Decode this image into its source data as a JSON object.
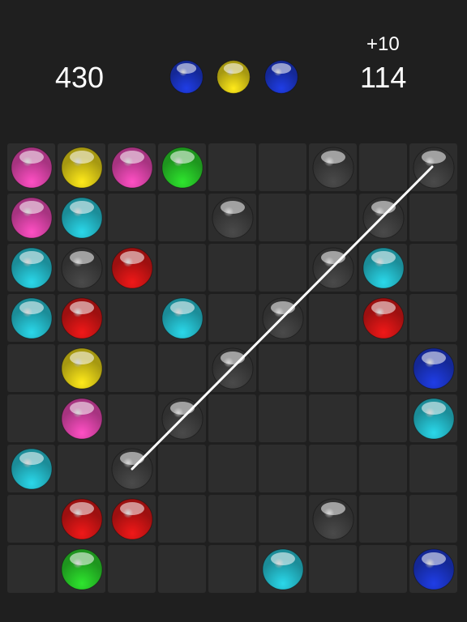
{
  "header": {
    "score": "430",
    "bonus": "+10",
    "counter": "114"
  },
  "next_balls": [
    "blue",
    "yellow",
    "blue"
  ],
  "colors": {
    "pink": "#ff4fc4",
    "yellow": "#ffea1a",
    "green": "#2ee52e",
    "cyan": "#2ad8ea",
    "red": "#f01818",
    "blue": "#1f3de6",
    "gray": "#4a4a4a"
  },
  "grid": {
    "rows": 9,
    "cols": 9,
    "cells": [
      [
        "pink",
        "yellow",
        "pink",
        "green",
        null,
        null,
        "gray",
        null,
        "gray"
      ],
      [
        "pink",
        "cyan",
        null,
        null,
        "gray",
        null,
        null,
        "gray",
        null
      ],
      [
        "cyan",
        "gray",
        "red",
        null,
        null,
        null,
        "gray",
        "cyan",
        null
      ],
      [
        "cyan",
        "red",
        null,
        "cyan",
        null,
        "gray",
        null,
        "red",
        null
      ],
      [
        null,
        "yellow",
        null,
        null,
        "gray",
        null,
        null,
        null,
        "blue"
      ],
      [
        null,
        "pink",
        null,
        "gray",
        null,
        null,
        null,
        null,
        "cyan"
      ],
      [
        "cyan",
        null,
        "gray",
        null,
        null,
        null,
        null,
        null,
        null
      ],
      [
        null,
        "red",
        "red",
        null,
        null,
        null,
        "gray",
        null,
        null
      ],
      [
        null,
        "green",
        null,
        null,
        null,
        "cyan",
        null,
        null,
        "blue"
      ]
    ]
  }
}
